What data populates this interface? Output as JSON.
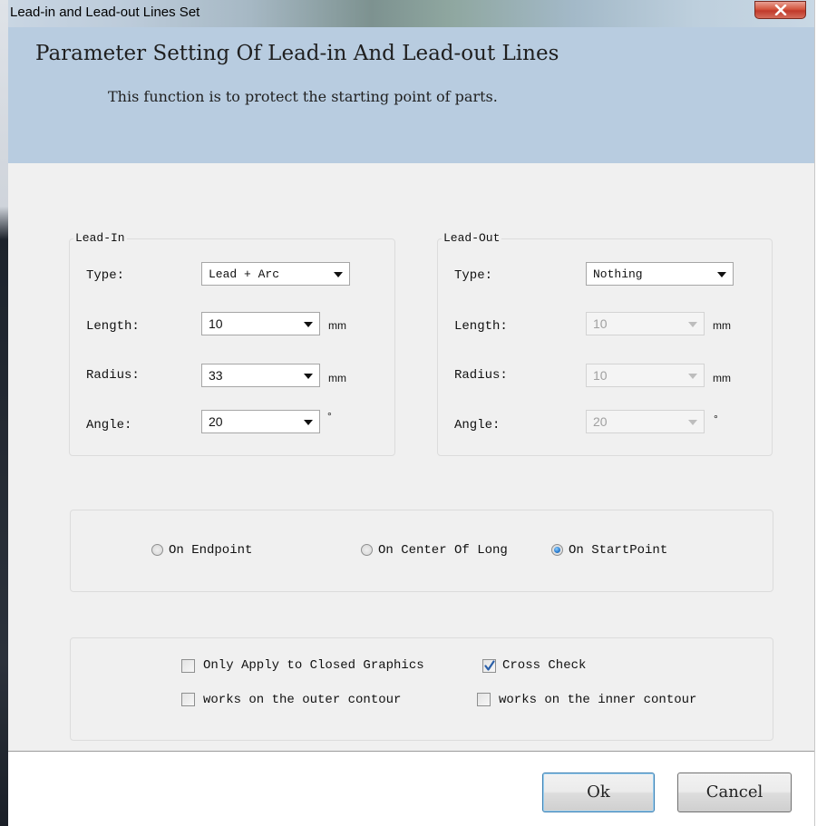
{
  "window": {
    "title": "Lead-in and Lead-out Lines Set"
  },
  "header": {
    "title": "Parameter Setting Of Lead-in And Lead-out Lines",
    "subtitle": "This function is to protect the starting point of parts."
  },
  "lead_in": {
    "legend": "Lead-In",
    "type_label": "Type:",
    "type_value": "Lead + Arc",
    "length_label": "Length:",
    "length_value": "10",
    "length_unit": "mm",
    "radius_label": "Radius:",
    "radius_value": "33",
    "radius_unit": "mm",
    "angle_label": "Angle:",
    "angle_value": "20",
    "angle_unit": "°"
  },
  "lead_out": {
    "legend": "Lead-Out",
    "type_label": "Type:",
    "type_value": "Nothing",
    "length_label": "Length:",
    "length_value": "10",
    "length_unit": "mm",
    "radius_label": "Radius:",
    "radius_value": "10",
    "radius_unit": "mm",
    "angle_label": "Angle:",
    "angle_value": "20",
    "angle_unit": "°"
  },
  "position": {
    "options": [
      {
        "label": "On Endpoint",
        "selected": false
      },
      {
        "label": "On Center Of Long",
        "selected": false
      },
      {
        "label": "On StartPoint",
        "selected": true
      }
    ]
  },
  "options": {
    "only_closed": {
      "label": "Only Apply to Closed Graphics",
      "checked": false
    },
    "cross_check": {
      "label": "Cross Check",
      "checked": true
    },
    "outer_contour": {
      "label": "works on the outer contour",
      "checked": false
    },
    "inner_contour": {
      "label": "works on the inner contour",
      "checked": false
    }
  },
  "buttons": {
    "ok": "Ok",
    "cancel": "Cancel"
  },
  "colors": {
    "header_bg": "#b8cce0",
    "dialog_bg": "#f0f0f0",
    "close_button": "#c0392b",
    "radio_selected": "#2f7fd0"
  }
}
